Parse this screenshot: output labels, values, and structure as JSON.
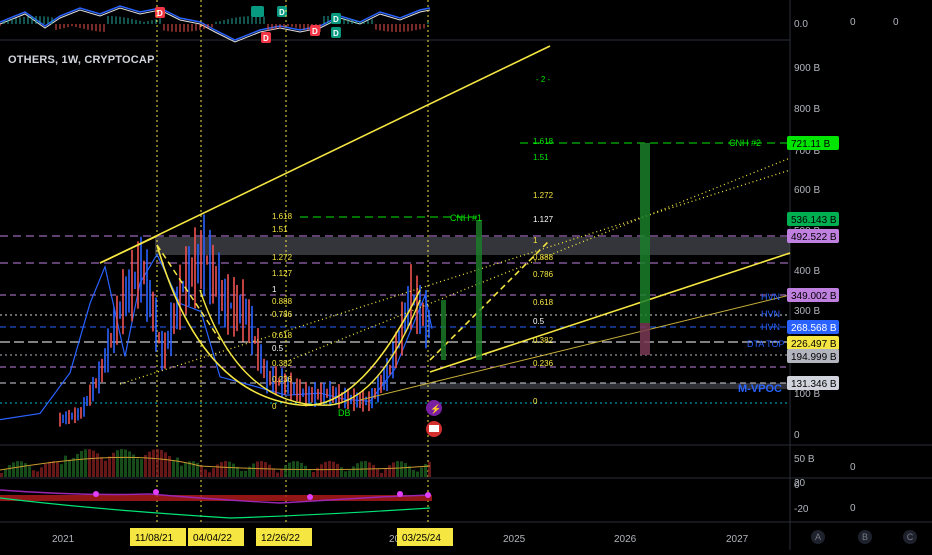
{
  "chart_title": "OTHERS, 1W, CRYPTOCAP",
  "osc_top": {
    "values": [
      "0.0",
      "0",
      "0"
    ],
    "signals": [
      "D",
      "D",
      "D",
      "D",
      "D",
      "D",
      "D"
    ]
  },
  "price_axis": {
    "ticks": [
      "900 B",
      "800 B",
      "700 B",
      "600 B",
      "500 B",
      "400 B",
      "300 B",
      "200 B",
      "100 B",
      "0"
    ]
  },
  "price_tags": [
    {
      "label": "721.11 B",
      "color": "#00e600",
      "text_color": "#000000"
    },
    {
      "label": "536.143 B",
      "color": "#00b050",
      "text_color": "#000000"
    },
    {
      "label": "492.522 B",
      "color": "#c080e0",
      "text_color": "#000000"
    },
    {
      "label": "349.002 B",
      "color": "#c080e0",
      "text_color": "#000000"
    },
    {
      "label": "268.568 B",
      "color": "#2962ff",
      "text_color": "#ffffff"
    },
    {
      "label": "226.497 B",
      "color": "#f5e642",
      "text_color": "#000000"
    },
    {
      "label": "194.999 B",
      "color": "#b2b5be",
      "text_color": "#000000"
    },
    {
      "label": "131.346 B",
      "color": "#d1d4dc",
      "text_color": "#000000"
    }
  ],
  "level_labels": [
    "CNH #2",
    "CNH #1",
    "HVN",
    "HVN",
    "HVN",
    "DTA TOP",
    "M-VPOC",
    "DB"
  ],
  "fib_left": [
    "1.618",
    "1.51",
    "1.272",
    "1.127",
    "1",
    "0.888",
    "0.786",
    "0.618",
    "0.5",
    "0.382",
    "0.236",
    "0"
  ],
  "fib_right": [
    "1.618",
    "1.51",
    "1.272",
    "1.127",
    "1",
    "0.888",
    "0.786",
    "0.618",
    "0.5",
    "0.382",
    "0.236",
    "0"
  ],
  "extra_label": "2",
  "volume_panel": {
    "ticks": [
      "50 B",
      "0"
    ],
    "value": "0"
  },
  "lower_panel": {
    "ticks": [
      "20",
      "0",
      "-20"
    ],
    "value": "0"
  },
  "time_axis": {
    "ticks": [
      "2021",
      "2023",
      "2025",
      "2026",
      "2027"
    ],
    "highlighted": [
      "11/08/21",
      "04/04/22",
      "12/26/22",
      "03/25/24"
    ]
  },
  "buttons": [
    "A",
    "B",
    "C"
  ],
  "chart_data": {
    "type": "line",
    "series": [
      {
        "x": [
          "2020-06",
          "2020-10",
          "2021-01",
          "2021-03",
          "2021-05",
          "2021-07",
          "2021-09",
          "2021-11",
          "2022-01",
          "2022-04",
          "2022-06",
          "2022-09",
          "2022-12",
          "2023-03",
          "2023-06",
          "2023-09",
          "2023-12",
          "2024-03",
          "2024-05"
        ],
        "values": [
          45,
          60,
          160,
          330,
          420,
          200,
          380,
          450,
          330,
          310,
          150,
          130,
          105,
          110,
          95,
          90,
          170,
          349,
          268
        ]
      }
    ],
    "ylim": [
      0,
      950
    ]
  }
}
